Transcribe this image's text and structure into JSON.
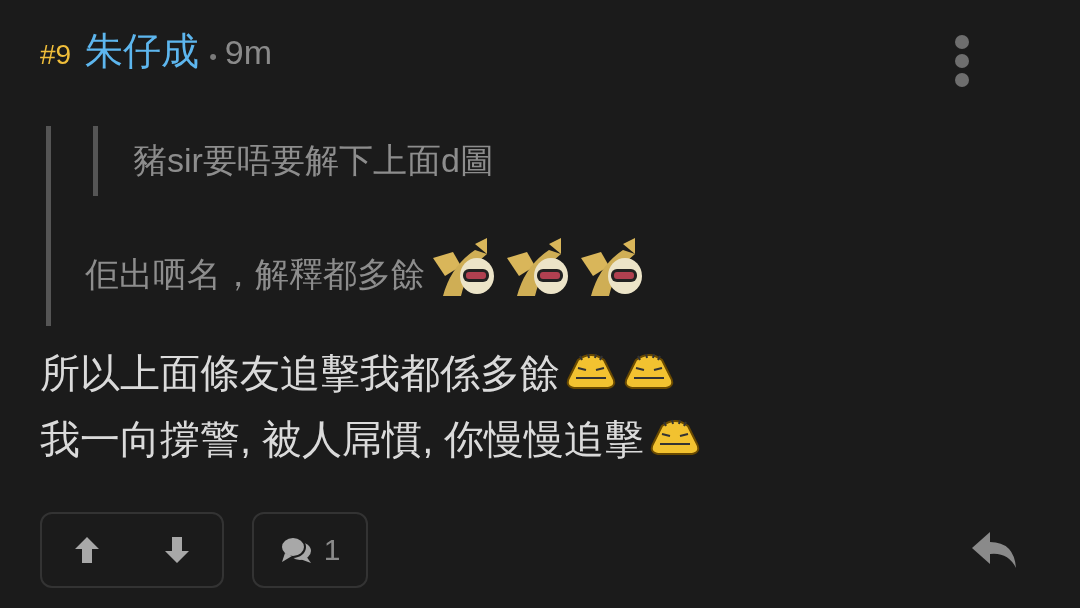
{
  "post": {
    "number": "#9",
    "author": "朱仔成",
    "separator": "•",
    "time": "9m"
  },
  "quote": {
    "nested_quote": {
      "text": "豬sir要唔要解下上面d圖"
    },
    "segments": [
      {
        "kind": "text",
        "text": "佢出哂名，解釋都多餘"
      },
      {
        "kind": "horned"
      },
      {
        "kind": "horned"
      },
      {
        "kind": "horned"
      }
    ]
  },
  "body": {
    "lines": [
      {
        "segments": [
          {
            "kind": "text",
            "text": "所以上面條友追擊我都係多餘"
          },
          {
            "kind": "blob"
          },
          {
            "kind": "blob"
          }
        ]
      },
      {
        "segments": [
          {
            "kind": "text",
            "text": "我一向撐警, 被人屌慣, 你慢慢追擊"
          },
          {
            "kind": "blob"
          }
        ]
      }
    ]
  },
  "actions": {
    "comment_count": "1"
  }
}
